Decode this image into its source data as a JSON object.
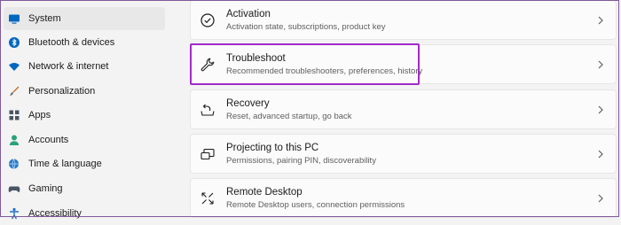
{
  "sidebar": {
    "items": [
      {
        "label": "System",
        "icon": "monitor-icon",
        "active": true
      },
      {
        "label": "Bluetooth & devices",
        "icon": "bluetooth-icon"
      },
      {
        "label": "Network & internet",
        "icon": "wifi-icon"
      },
      {
        "label": "Personalization",
        "icon": "paintbrush-icon"
      },
      {
        "label": "Apps",
        "icon": "apps-grid-icon"
      },
      {
        "label": "Accounts",
        "icon": "person-icon"
      },
      {
        "label": "Time & language",
        "icon": "globe-clock-icon"
      },
      {
        "label": "Gaming",
        "icon": "gamepad-icon"
      },
      {
        "label": "Accessibility",
        "icon": "accessibility-icon"
      }
    ]
  },
  "cards": [
    {
      "title": "Activation",
      "subtitle": "Activation state, subscriptions, product key",
      "icon": "check-circle-icon"
    },
    {
      "title": "Troubleshoot",
      "subtitle": "Recommended troubleshooters, preferences, history",
      "icon": "wrench-icon"
    },
    {
      "title": "Recovery",
      "subtitle": "Reset, advanced startup, go back",
      "icon": "recovery-icon"
    },
    {
      "title": "Projecting to this PC",
      "subtitle": "Permissions, pairing PIN, discoverability",
      "icon": "projector-icon"
    },
    {
      "title": "Remote Desktop",
      "subtitle": "Remote Desktop users, connection permissions",
      "icon": "remote-desktop-icon"
    }
  ],
  "colors": {
    "highlight": "#a22bc9",
    "accent": "#0067c0"
  }
}
